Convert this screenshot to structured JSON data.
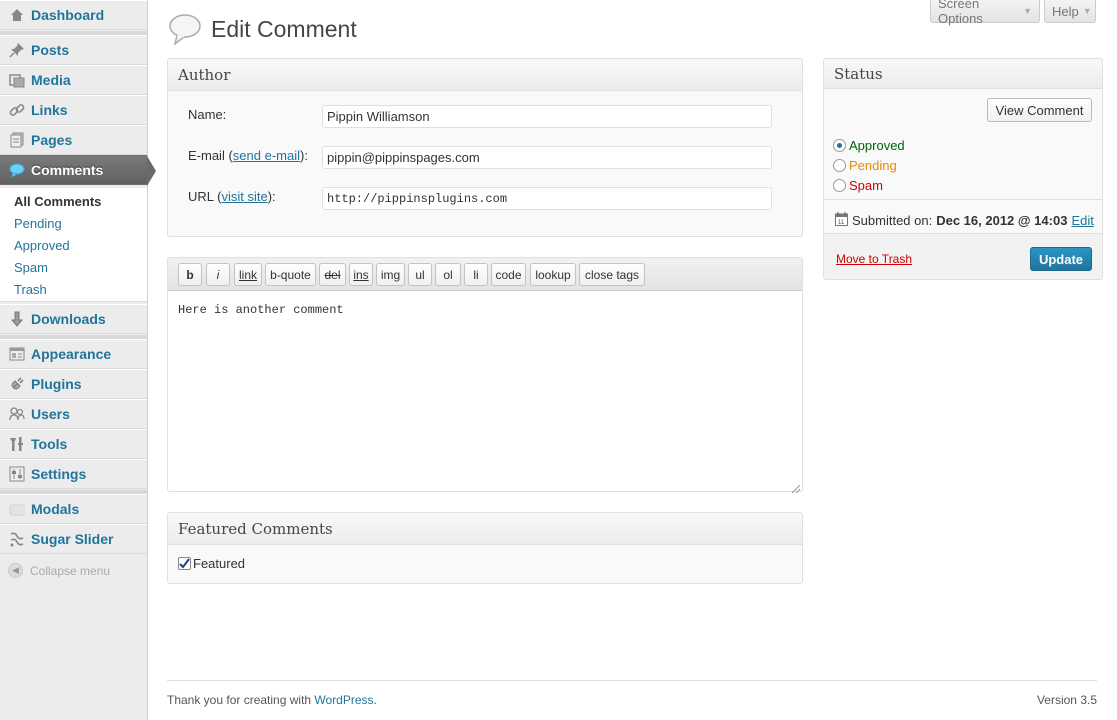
{
  "sidebar": {
    "items": [
      {
        "label": "Dashboard",
        "icon": "dashboard-icon"
      },
      {
        "label": "Posts",
        "icon": "pushpin-icon"
      },
      {
        "label": "Media",
        "icon": "media-icon"
      },
      {
        "label": "Links",
        "icon": "chain-link-icon"
      },
      {
        "label": "Pages",
        "icon": "pages-icon"
      },
      {
        "label": "Comments",
        "icon": "speech-bubble-icon"
      },
      {
        "label": "Downloads",
        "icon": "download-arrow-icon"
      },
      {
        "label": "Appearance",
        "icon": "appearance-icon"
      },
      {
        "label": "Plugins",
        "icon": "plug-icon"
      },
      {
        "label": "Users",
        "icon": "users-icon"
      },
      {
        "label": "Tools",
        "icon": "tools-icon"
      },
      {
        "label": "Settings",
        "icon": "settings-icon"
      },
      {
        "label": "Modals",
        "icon": "modal-icon"
      },
      {
        "label": "Sugar Slider",
        "icon": "slider-icon"
      }
    ],
    "submenu": [
      "All Comments",
      "Pending",
      "Approved",
      "Spam",
      "Trash"
    ],
    "collapse_label": "Collapse menu"
  },
  "top": {
    "screen_options": "Screen Options",
    "help": "Help"
  },
  "page_title": "Edit Comment",
  "author_box": {
    "title": "Author",
    "name_label": "Name:",
    "name_value": "Pippin Williamson",
    "email_label_prefix": "E-mail (",
    "email_link": "send e-mail",
    "email_label_suffix": "):",
    "email_value": "pippin@pippinspages.com",
    "url_label_prefix": "URL (",
    "url_link": "visit site",
    "url_label_suffix": "):",
    "url_value": "http://pippinsplugins.com"
  },
  "editor": {
    "buttons": [
      "b",
      "i",
      "link",
      "b-quote",
      "del",
      "ins",
      "img",
      "ul",
      "ol",
      "li",
      "code",
      "lookup",
      "close tags"
    ],
    "content": "Here is another comment"
  },
  "featured_box": {
    "title": "Featured Comments",
    "checkbox_label": "Featured",
    "checked": true
  },
  "status_box": {
    "title": "Status",
    "view_button": "View Comment",
    "options": [
      {
        "label": "Approved",
        "color": "#006505",
        "selected": true
      },
      {
        "label": "Pending",
        "color": "#e68a00",
        "selected": false
      },
      {
        "label": "Spam",
        "color": "#d00000",
        "selected": false
      }
    ],
    "submitted_label": "Submitted on:",
    "submitted_date": "Dec 16, 2012 @ 14:03",
    "edit_link": "Edit",
    "trash_link": "Move to Trash",
    "update_button": "Update"
  },
  "footer": {
    "thanks_prefix": "Thank you for creating with ",
    "wordpress_link": "WordPress",
    "thanks_suffix": ".",
    "version": "Version 3.5"
  },
  "colors": {
    "link": "#21759b",
    "approved": "#006505",
    "pending": "#e68a00",
    "spam": "#d00000",
    "primary": "#21759b"
  }
}
